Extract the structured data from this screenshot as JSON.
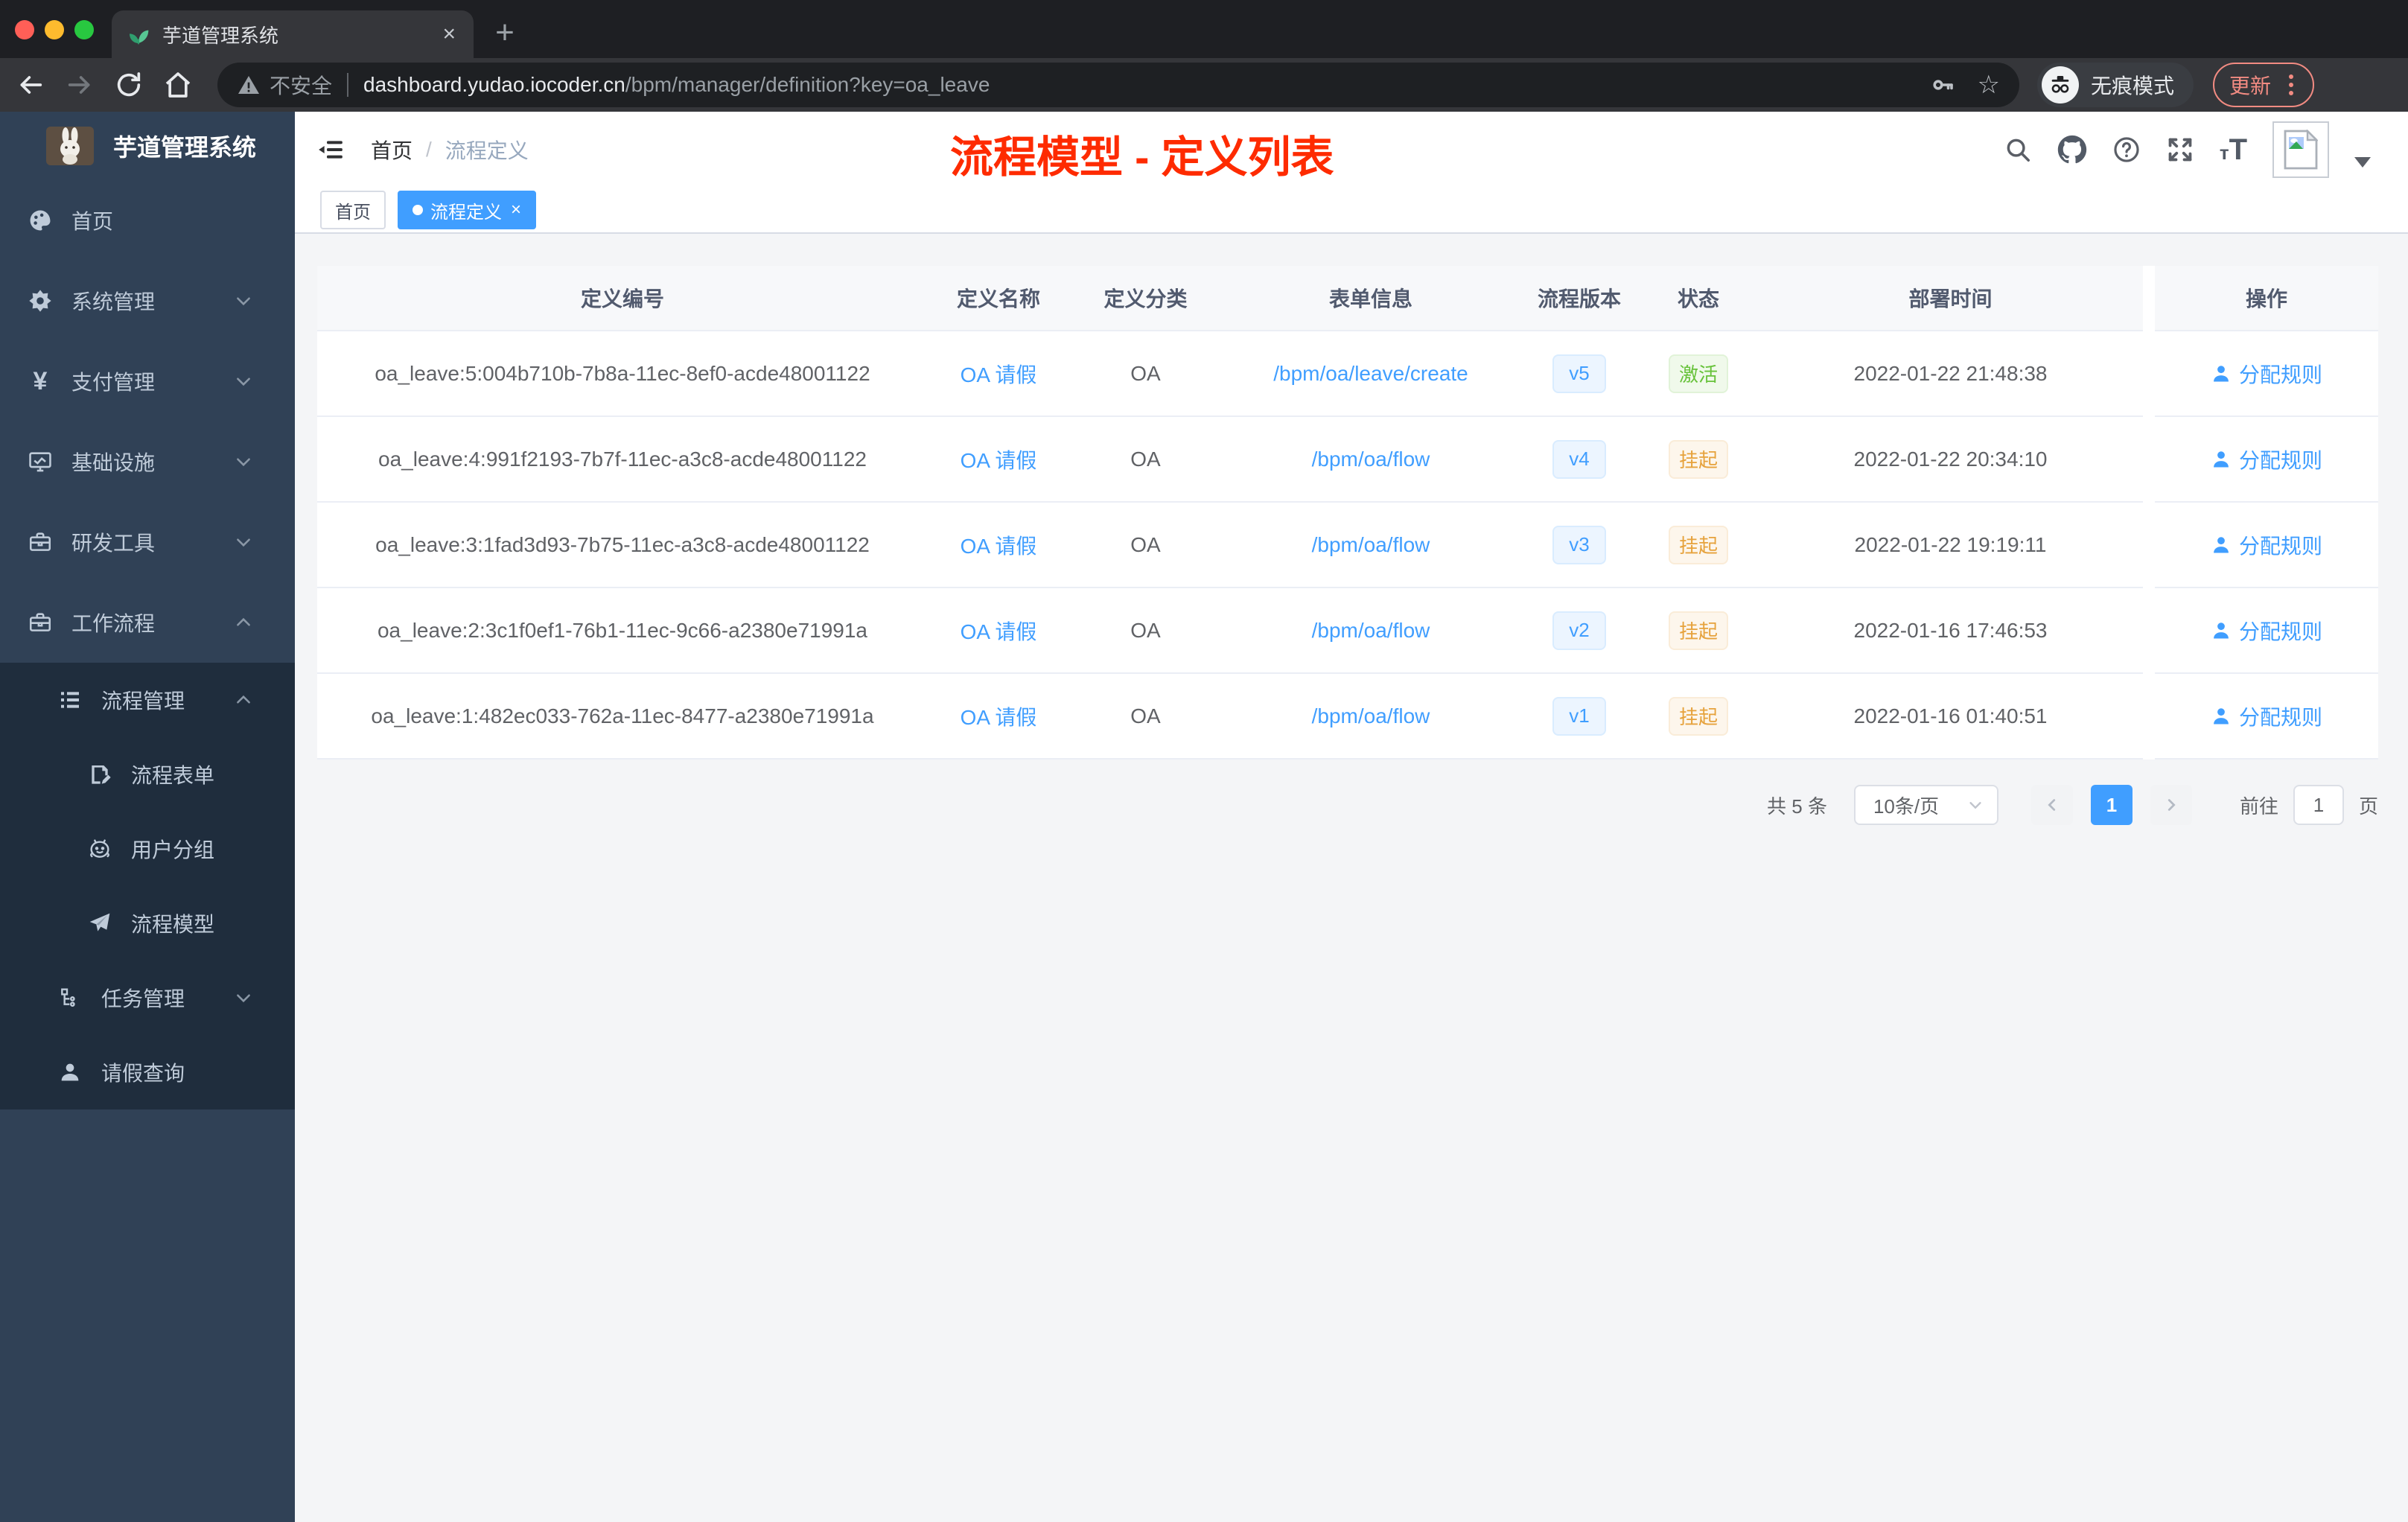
{
  "browser": {
    "tab": {
      "title": "芋道管理系统",
      "close": "×",
      "new_tab": "+"
    },
    "toolbar": {
      "security_label": "不安全",
      "url_host": "dashboard.yudao.iocoder.cn",
      "url_path": "/bpm/manager/definition?key=oa_leave",
      "star": "☆",
      "incognito_label": "无痕模式",
      "update_label": "更新"
    }
  },
  "sidebar": {
    "logo_title": "芋道管理系统",
    "items": [
      {
        "label": "首页",
        "icon": "dashboard-icon"
      },
      {
        "label": "系统管理",
        "icon": "gear-icon"
      },
      {
        "label": "支付管理",
        "icon": "yen-icon",
        "yen": "¥"
      },
      {
        "label": "基础设施",
        "icon": "monitor-icon"
      },
      {
        "label": "研发工具",
        "icon": "toolbox-icon"
      },
      {
        "label": "工作流程",
        "icon": "briefcase-icon"
      }
    ],
    "workflow_children": [
      {
        "label": "流程管理"
      },
      {
        "label": "流程表单"
      },
      {
        "label": "用户分组"
      },
      {
        "label": "流程模型"
      },
      {
        "label": "任务管理"
      },
      {
        "label": "请假查询"
      }
    ]
  },
  "navbar": {
    "breadcrumb": {
      "home": "首页",
      "separator": "/",
      "current": "流程定义"
    },
    "annotation": "流程模型 - 定义列表",
    "fontsize_icon_small": "т",
    "fontsize_icon_big": "T"
  },
  "tags": {
    "home": "首页",
    "active": "流程定义",
    "close": "×"
  },
  "table": {
    "headers": {
      "id": "定义编号",
      "name": "定义名称",
      "category": "定义分类",
      "form": "表单信息",
      "version": "流程版本",
      "status": "状态",
      "deploy_time": "部署时间",
      "actions": "操作"
    },
    "rows": [
      {
        "id": "oa_leave:5:004b710b-7b8a-11ec-8ef0-acde48001122",
        "name": "OA 请假",
        "category": "OA",
        "form": "/bpm/oa/leave/create",
        "version": "v5",
        "status": "激活",
        "deploy_time": "2022-01-22 21:48:38",
        "action": "分配规则"
      },
      {
        "id": "oa_leave:4:991f2193-7b7f-11ec-a3c8-acde48001122",
        "name": "OA 请假",
        "category": "OA",
        "form": "/bpm/oa/flow",
        "version": "v4",
        "status": "挂起",
        "deploy_time": "2022-01-22 20:34:10",
        "action": "分配规则"
      },
      {
        "id": "oa_leave:3:1fad3d93-7b75-11ec-a3c8-acde48001122",
        "name": "OA 请假",
        "category": "OA",
        "form": "/bpm/oa/flow",
        "version": "v3",
        "status": "挂起",
        "deploy_time": "2022-01-22 19:19:11",
        "action": "分配规则"
      },
      {
        "id": "oa_leave:2:3c1f0ef1-76b1-11ec-9c66-a2380e71991a",
        "name": "OA 请假",
        "category": "OA",
        "form": "/bpm/oa/flow",
        "version": "v2",
        "status": "挂起",
        "deploy_time": "2022-01-16 17:46:53",
        "action": "分配规则"
      },
      {
        "id": "oa_leave:1:482ec033-762a-11ec-8477-a2380e71991a",
        "name": "OA 请假",
        "category": "OA",
        "form": "/bpm/oa/flow",
        "version": "v1",
        "status": "挂起",
        "deploy_time": "2022-01-16 01:40:51",
        "action": "分配规则"
      }
    ]
  },
  "pagination": {
    "total": "共 5 条",
    "page_size": "10条/页",
    "current_page": "1",
    "goto_label": "前往",
    "goto_value": "1",
    "page_unit": "页"
  },
  "colors": {
    "accent_blue": "#409eff",
    "annotation_red": "#fe2b00",
    "status_active_green": "#67c23a",
    "status_suspended_orange": "#e6a23c",
    "sidebar_bg": "#304156",
    "sidebar_submenu_bg": "#1f2d3d",
    "tag_active_bg": "#409eff"
  }
}
